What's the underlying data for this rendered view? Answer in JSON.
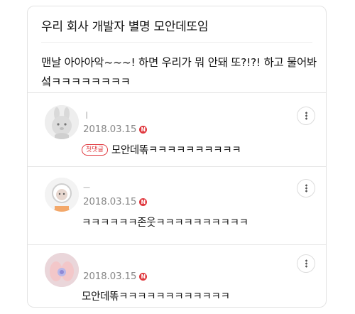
{
  "post": {
    "title": "우리 회사 개발자 별명 모안데또임",
    "body": "맨날 아아아악~~~! 하면 우리가 뭐 안돼 또?!?! 하고 물어봐섴ㅋㅋㅋㅋㅋㅋㅋㅋ"
  },
  "comments": [
    {
      "nickname": "ㅣ",
      "date": "2018.03.15",
      "new_badge": "N",
      "tag": "첫댓글",
      "text": "모안데똒ㅋㅋㅋㅋㅋㅋㅋㅋㅋㅋ",
      "avatar_icon": "rabbit-face-icon"
    },
    {
      "nickname": "ㅡ",
      "date": "2018.03.15",
      "new_badge": "N",
      "tag": "",
      "text": "ㅋㅋㅋㅋㅋㅋ존웃ㅋㅋㅋㅋㅋㅋㅋㅋㅋㅋ",
      "avatar_icon": "cartoon-character-icon"
    },
    {
      "nickname": "",
      "date": "2018.03.15",
      "new_badge": "N",
      "tag": "",
      "text": "모안데똒ㅋㅋㅋㅋㅋㅋㅋㅋㅋㅋㅋㅋ",
      "avatar_icon": "hands-photo-icon"
    }
  ],
  "icons": {
    "more": "more-vertical-icon"
  },
  "colors": {
    "accent_red": "#e0383e",
    "meta_gray": "#888888",
    "divider": "#e6e6e6"
  }
}
